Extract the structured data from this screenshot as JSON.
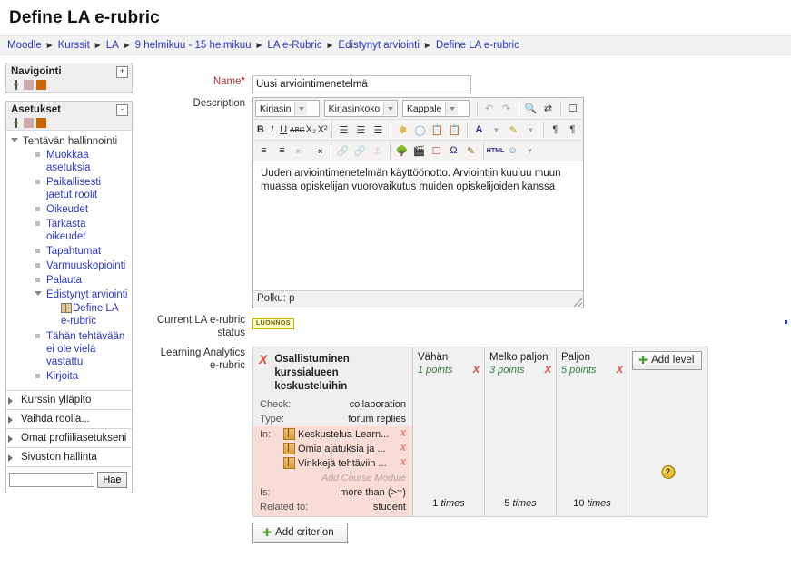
{
  "page": {
    "title": "Define LA e-rubric"
  },
  "breadcrumb": [
    "Moodle",
    "Kurssit",
    "LA",
    "9 helmikuu - 15 helmikuu",
    "LA e-Rubric",
    "Edistynyt arviointi",
    "Define LA e-rubric"
  ],
  "sidebar": {
    "blocks": [
      {
        "title": "Navigointi",
        "toggle": "+",
        "collapsed": true
      },
      {
        "title": "Asetukset",
        "toggle": "-",
        "collapsed": false
      }
    ],
    "settings_tree": {
      "root_label": "Tehtävän hallinnointi",
      "items": [
        "Muokkaa asetuksia",
        "Paikallisesti jaetut roolit",
        "Oikeudet",
        "Tarkasta oikeudet",
        "Tapahtumat",
        "Varmuuskopiointi",
        "Palauta"
      ],
      "advanced_label": "Edistynyt arviointi",
      "advanced_children": [
        "Define LA e-rubric"
      ],
      "after_items": [
        "Tähän tehtävään ei ole vielä vastattu",
        "Kirjoita"
      ]
    },
    "collapsed_sections": [
      "Kurssin ylläpito",
      "Vaihda roolia...",
      "Omat profiiliasetukseni",
      "Sivuston hallinta"
    ],
    "search": {
      "value": "",
      "button_label": "Hae"
    }
  },
  "form": {
    "name_label": "Name",
    "name_required_mark": "*",
    "name_value": "Uusi arviointimenetelmä",
    "description_label": "Description",
    "description_text": "Uuden arviointimenetelmän käyttöönotto. Arviointiin kuuluu muun muassa opiskelijan vuorovaikutus muiden opiskelijoiden kanssa",
    "editor": {
      "font_select": "Kirjasin",
      "size_select": "Kirjasinkoko",
      "format_select": "Kappale",
      "status_path": "Polku: p",
      "row1_icons": [
        "undo-icon",
        "redo-icon",
        "find-icon",
        "find-replace-icon",
        "fullscreen-icon"
      ],
      "row2_icons": [
        "bold-icon",
        "italic-icon",
        "underline-icon",
        "strikethrough-icon",
        "subscript-icon",
        "superscript-icon",
        "align-left-icon",
        "align-center-icon",
        "align-right-icon",
        "clean-format-icon",
        "remove-format-icon",
        "paste-text-icon",
        "paste-word-icon",
        "text-color-icon",
        "background-color-icon",
        "ltr-icon",
        "rtl-icon"
      ],
      "row3_icons": [
        "unordered-list-icon",
        "ordered-list-icon",
        "outdent-icon",
        "indent-icon",
        "link-icon",
        "unlink-icon",
        "anchor-icon",
        "image-icon",
        "media-icon",
        "nonbreaking-icon",
        "special-char-icon",
        "equation-icon",
        "html-source-icon",
        "emoticon-icon",
        "emoticon-caret-icon"
      ]
    },
    "status_label_line1": "Current LA e-rubric",
    "status_label_line2": "status",
    "status_badge": "LUONNOS",
    "rubric_label_line1": "Learning Analytics",
    "rubric_label_line2": "e-rubric"
  },
  "rubric": {
    "criterion": {
      "name": "Osallistuminen kurssialueen keskusteluihin",
      "delete_mark": "X",
      "fields": [
        {
          "key": "Check:",
          "value": "collaboration"
        },
        {
          "key": "Type:",
          "value": "forum replies"
        }
      ],
      "in_label": "In:",
      "in_items": [
        "Keskustelua Learn...",
        "Omia ajatuksia ja ...",
        "Vinkkejä tehtäviin ..."
      ],
      "add_module_label": "Add Course Module",
      "tail_fields": [
        {
          "key": "Is:",
          "value": "more than (>=)"
        },
        {
          "key": "Related to:",
          "value": "student"
        }
      ]
    },
    "levels": [
      {
        "name": "Vähän",
        "points": "1 points",
        "times": "1",
        "times_unit": "times"
      },
      {
        "name": "Melko paljon",
        "points": "3 points",
        "times": "5",
        "times_unit": "times"
      },
      {
        "name": "Paljon",
        "points": "5 points",
        "times": "10",
        "times_unit": "times"
      }
    ],
    "level_delete_mark": "X",
    "add_level_label": "Add level",
    "add_criterion_label": "Add criterion",
    "help_icon_label": "?"
  },
  "colors": {
    "link": "#2b37c8",
    "delete_red": "#e2493a",
    "points_green": "#3a7a4a",
    "in_block_pink": "#fadcd7",
    "badge_yellow": "#ffffc8",
    "plus_green": "#4f9c36"
  }
}
